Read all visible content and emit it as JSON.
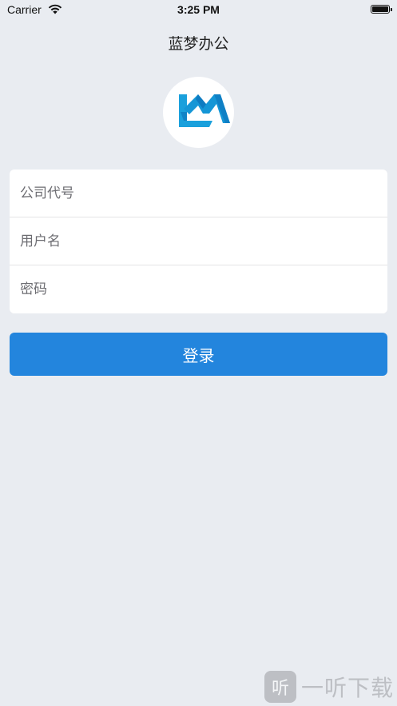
{
  "status_bar": {
    "carrier": "Carrier",
    "time": "3:25 PM"
  },
  "nav": {
    "title": "蓝梦办公"
  },
  "logo": {
    "icon": "lm-logo",
    "colors": [
      "#1aa0dc",
      "#0b6fb8"
    ]
  },
  "form": {
    "company_code_placeholder": "公司代号",
    "username_placeholder": "用户名",
    "password_placeholder": "密码"
  },
  "login_button": {
    "label": "登录",
    "color": "#2385dd"
  },
  "watermark": {
    "icon_glyph": "听",
    "text": "一听下载"
  },
  "colors": {
    "background": "#e9ecf1",
    "card": "#ffffff"
  }
}
